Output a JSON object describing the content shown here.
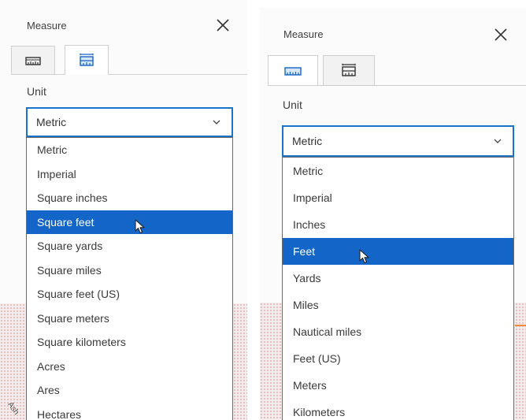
{
  "left_panel": {
    "title": "Measure",
    "unit_label": "Unit",
    "selected_value": "Metric",
    "options": [
      "Metric",
      "Imperial",
      "Square inches",
      "Square feet",
      "Square yards",
      "Square miles",
      "Square feet (US)",
      "Square meters",
      "Square kilometers",
      "Acres",
      "Ares",
      "Hectares"
    ],
    "highlighted_index": 3,
    "active_tab": "area"
  },
  "right_panel": {
    "title": "Measure",
    "unit_label": "Unit",
    "selected_value": "Metric",
    "options": [
      "Metric",
      "Imperial",
      "Inches",
      "Feet",
      "Yards",
      "Miles",
      "Nautical miles",
      "Feet (US)",
      "Meters",
      "Kilometers"
    ],
    "highlighted_index": 3,
    "active_tab": "distance"
  },
  "map": {
    "road_label": "Ash"
  },
  "colors": {
    "accent": "#1465c8",
    "focus_border": "#1a73c9",
    "map_line": "#f08a3a"
  },
  "icons": {
    "close": "close-icon",
    "distance_tab": "ruler-icon",
    "area_tab": "area-ruler-icon",
    "dropdown": "chevron-down-icon",
    "cursor": "mouse-pointer-icon"
  }
}
